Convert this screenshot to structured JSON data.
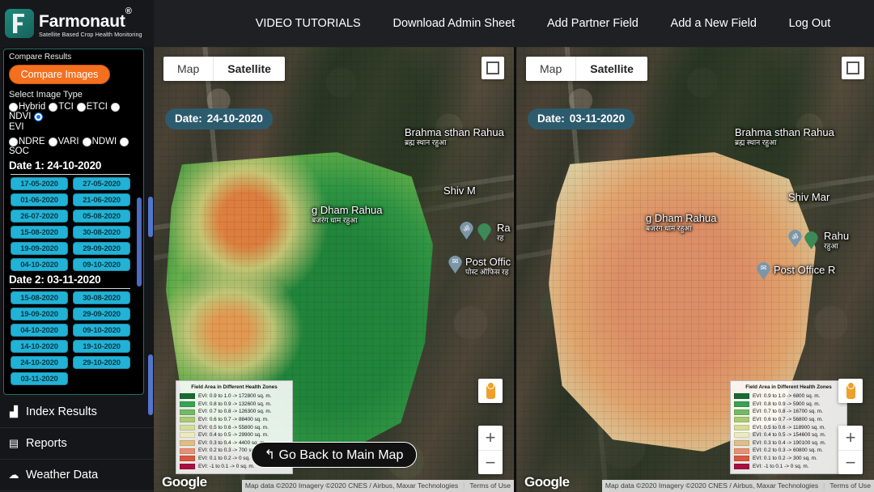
{
  "brand": {
    "name": "Farmonaut",
    "trademark": "®",
    "tagline": "Satellite Based Crop Health Monitoring",
    "logo_icon": "leaf-f-logo-icon"
  },
  "nav": {
    "items": [
      {
        "label": "VIDEO TUTORIALS"
      },
      {
        "label": "Download Admin Sheet"
      },
      {
        "label": "Add Partner Field"
      },
      {
        "label": "Add a New Field"
      },
      {
        "label": "Log Out"
      }
    ]
  },
  "sidebar": {
    "compare_label": "Compare Results",
    "compare_button": "Compare Images",
    "image_type_label": "Select Image Type",
    "image_types_row1": [
      {
        "label": "Hybrid",
        "selected": false
      },
      {
        "label": "TCI",
        "selected": false
      },
      {
        "label": "ETCI",
        "selected": false
      },
      {
        "label": "NDVI",
        "selected": false
      },
      {
        "label": "EVI",
        "selected": true
      }
    ],
    "image_types_row2": [
      {
        "label": "NDRE",
        "selected": false
      },
      {
        "label": "VARI",
        "selected": false
      },
      {
        "label": "NDWI",
        "selected": false
      },
      {
        "label": "SOC",
        "selected": false
      }
    ],
    "date1_heading": "Date 1: 24-10-2020",
    "date1_options": [
      "17-05-2020",
      "27-05-2020",
      "01-06-2020",
      "21-06-2020",
      "26-07-2020",
      "05-08-2020",
      "15-08-2020",
      "30-08-2020",
      "19-09-2020",
      "29-09-2020",
      "04-10-2020",
      "09-10-2020"
    ],
    "date2_heading": "Date 2: 03-11-2020",
    "date2_options": [
      "15-08-2020",
      "30-08-2020",
      "19-09-2020",
      "29-09-2020",
      "04-10-2020",
      "09-10-2020",
      "14-10-2020",
      "19-10-2020",
      "24-10-2020",
      "29-10-2020",
      "03-11-2020"
    ],
    "bottom_nav": [
      {
        "label": "Index Results",
        "icon": "bar-chart-icon",
        "glyph": "▟"
      },
      {
        "label": "Reports",
        "icon": "clipboard-icon",
        "glyph": "▤"
      },
      {
        "label": "Weather Data",
        "icon": "cloud-icon",
        "glyph": "☁"
      }
    ]
  },
  "maps": {
    "left": {
      "map_button": "Map",
      "satellite_button": "Satellite",
      "satellite_active": true,
      "date_key": "Date:",
      "date_value": "24-10-2020",
      "fullscreen_icon": "fullscreen-icon",
      "pegman_icon": "street-view-pegman-icon",
      "zoom_in": "+",
      "zoom_out": "−",
      "watermark": "Google",
      "attribution": "Map data ©2020 Imagery ©2020 CNES / Airbus, Maxar Technologies",
      "terms": "Terms of Use",
      "labels": [
        {
          "name": "Brahma sthan Rahua",
          "native": "ब्रह्म स्थान रहुआ"
        },
        {
          "name": "Shiv M",
          "native": ""
        },
        {
          "name": "g Dham Rahua",
          "native": "बजरंग धाम रहुआ"
        },
        {
          "name": "Ra",
          "native": "रह"
        },
        {
          "name": "Post Offic",
          "native": "पोस्ट ऑफिस रह"
        }
      ],
      "legend": {
        "title": "Field Area in Different Health Zones",
        "rows": [
          {
            "range": "EVI: 0.9 to 1.0",
            "value": "172800 sq. m.",
            "color": "#176b32"
          },
          {
            "range": "EVI: 0.8 to 0.9",
            "value": "132600 sq. m.",
            "color": "#37a351"
          },
          {
            "range": "EVI: 0.7 to 0.8",
            "value": "126300 sq. m.",
            "color": "#73ba62"
          },
          {
            "range": "EVI: 0.6 to 0.7",
            "value": "88400 sq. m.",
            "color": "#a8cc74"
          },
          {
            "range": "EVI: 0.5 to 0.6",
            "value": "55800 sq. m.",
            "color": "#d4de9a"
          },
          {
            "range": "EVI: 0.4 to 0.5",
            "value": "29900 sq. m.",
            "color": "#ecebc0"
          },
          {
            "range": "EVI: 0.3 to 0.4",
            "value": "4400 sq. m.",
            "color": "#e0bf85"
          },
          {
            "range": "EVI: 0.2 to 0.3",
            "value": "700 sq. m.",
            "color": "#e79172"
          },
          {
            "range": "EVI: 0.1 to 0.2",
            "value": "0 sq. m.",
            "color": "#d9573f"
          },
          {
            "range": "EVI: -1 to 0.1",
            "value": "0 sq. m.",
            "color": "#a81040"
          }
        ]
      }
    },
    "right": {
      "map_button": "Map",
      "satellite_button": "Satellite",
      "satellite_active": true,
      "date_key": "Date:",
      "date_value": "03-11-2020",
      "fullscreen_icon": "fullscreen-icon",
      "pegman_icon": "street-view-pegman-icon",
      "zoom_in": "+",
      "zoom_out": "−",
      "watermark": "Google",
      "attribution": "Map data ©2020 Imagery ©2020 CNES / Airbus, Maxar Technologies",
      "terms": "Terms of Use",
      "labels": [
        {
          "name": "Brahma sthan Rahua",
          "native": "ब्रह्म स्थान रहुआ"
        },
        {
          "name": "Shiv Mar",
          "native": ""
        },
        {
          "name": "g Dham Rahua",
          "native": "बजरंग धाम रहुआ"
        },
        {
          "name": "Rahu",
          "native": "रहुआ"
        },
        {
          "name": "Post Office R",
          "native": ""
        }
      ],
      "legend": {
        "title": "Field Area in Different Health Zones",
        "rows": [
          {
            "range": "EVI: 0.9 to 1.0",
            "value": "6800 sq. m.",
            "color": "#176b32"
          },
          {
            "range": "EVI: 0.8 to 0.9",
            "value": "5900 sq. m.",
            "color": "#37a351"
          },
          {
            "range": "EVI: 0.7 to 0.8",
            "value": "16700 sq. m.",
            "color": "#73ba62"
          },
          {
            "range": "EVI: 0.6 to 0.7",
            "value": "56800 sq. m.",
            "color": "#a8cc74"
          },
          {
            "range": "EVI: 0.5 to 0.6",
            "value": "118900 sq. m.",
            "color": "#d4de9a"
          },
          {
            "range": "EVI: 0.4 to 0.5",
            "value": "154600 sq. m.",
            "color": "#ecebc0"
          },
          {
            "range": "EVI: 0.3 to 0.4",
            "value": "190100 sq. m.",
            "color": "#e0bf85"
          },
          {
            "range": "EVI: 0.2 to 0.3",
            "value": "60800 sq. m.",
            "color": "#e79172"
          },
          {
            "range": "EVI: 0.1 to 0.2",
            "value": "300 sq. m.",
            "color": "#d9573f"
          },
          {
            "range": "EVI: -1 to 0.1",
            "value": "0 sq. m.",
            "color": "#a81040"
          }
        ]
      }
    }
  },
  "go_back_button": "Go Back to Main Map",
  "go_back_icon": "back-arrow-icon",
  "colors": {
    "accent_orange": "#f4701f",
    "date_button": "#22b2d6",
    "panel_border": "#1f6f66",
    "radio_selected": "#1878e8",
    "topbar_bg": "#1e2024"
  }
}
